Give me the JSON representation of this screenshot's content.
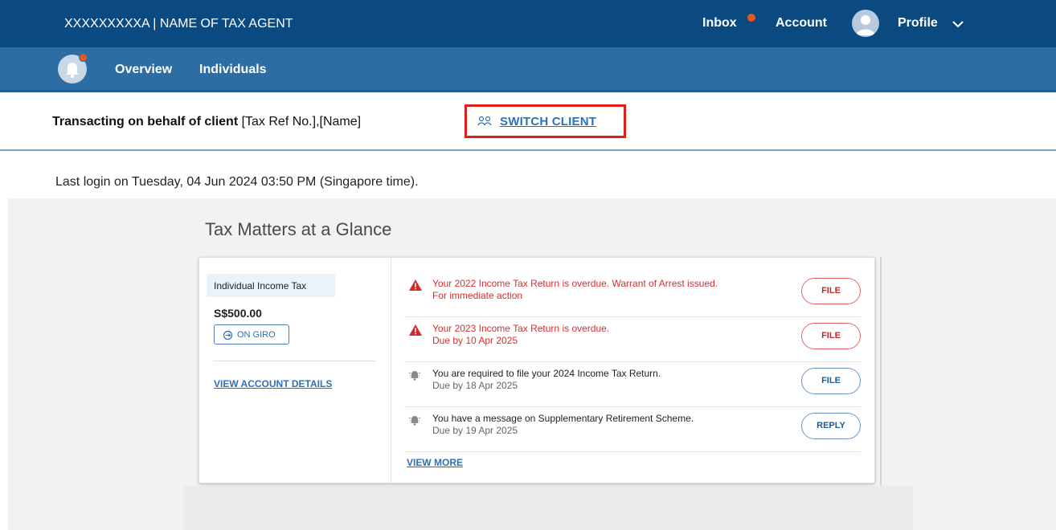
{
  "header": {
    "agent_label": "XXXXXXXXXA | NAME OF TAX AGENT",
    "inbox": "Inbox",
    "account": "Account",
    "profile": "Profile"
  },
  "nav": {
    "overview": "Overview",
    "individuals": "Individuals"
  },
  "client_bar": {
    "transacting_bold": "Transacting on behalf of client",
    "transacting_rest": " [Tax Ref No.],[Name]",
    "switch_label": "SWITCH CLIENT"
  },
  "last_login": "Last login on Tuesday, 04 Jun 2024 03:50 PM (Singapore time).",
  "glance": {
    "title": "Tax Matters at a Glance",
    "tax_type": "Individual Income Tax",
    "amount": "S$500.00",
    "giro_label": "ON GIRO",
    "view_account": "VIEW ACCOUNT DETAILS",
    "view_more": "VIEW MORE",
    "notifications": [
      {
        "line1": "Your 2022 Income Tax Return is overdue. Warrant of Arrest issued.",
        "line2": "For immediate action",
        "action": "FILE",
        "severity": "alert"
      },
      {
        "line1": "Your 2023 Income Tax Return is overdue.",
        "line2": "Due by 10 Apr 2025",
        "action": "FILE",
        "severity": "alert"
      },
      {
        "line1": "You are required to file your 2024 Income Tax Return.",
        "line2": "Due by 18 Apr 2025",
        "action": "FILE",
        "severity": "reminder"
      },
      {
        "line1": "You have a message on Supplementary Retirement Scheme.",
        "line2": "Due by 19 Apr 2025",
        "action": "REPLY",
        "severity": "reminder"
      }
    ]
  },
  "colors": {
    "header_bg": "#0a4a80",
    "nav_bg": "#2c6ea3",
    "accent_link": "#2d70b6",
    "alert_red": "#d42f2f",
    "notification_dot": "#e8571e",
    "highlight_box": "#e0201b"
  },
  "icons": {
    "bell": "bell-icon",
    "user": "user-avatar-icon",
    "switch": "switch-client-icon",
    "giro": "giro-icon",
    "warning": "warning-triangle-icon",
    "reminder": "reminder-bell-icon"
  }
}
